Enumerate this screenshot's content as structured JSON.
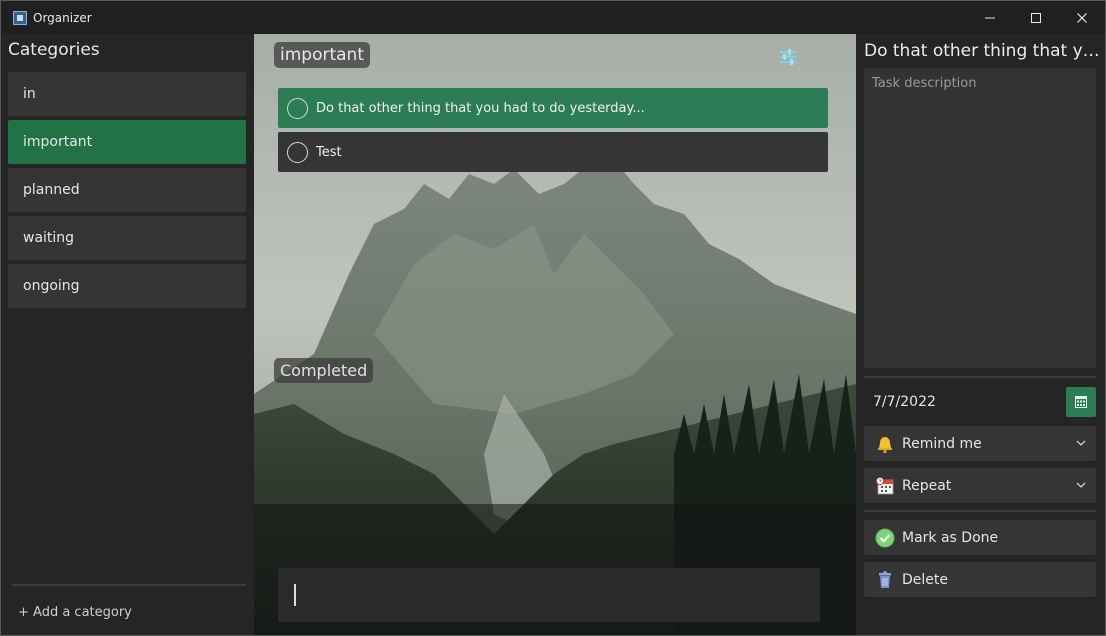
{
  "window": {
    "title": "Organizer",
    "icons": [
      "app-icon",
      "minimize-icon",
      "maximize-icon",
      "close-icon"
    ]
  },
  "sidebar": {
    "title": "Categories",
    "items": [
      {
        "label": "in",
        "selected": false
      },
      {
        "label": "important",
        "selected": true
      },
      {
        "label": "planned",
        "selected": false
      },
      {
        "label": "waiting",
        "selected": false
      },
      {
        "label": "ongoing",
        "selected": false
      }
    ],
    "add_label": "+ Add a category"
  },
  "main": {
    "list_title": "important",
    "filter_icon": "sliders-icon",
    "tasks": [
      {
        "label": "Do that other thing that you had to do yesterday...",
        "selected": true
      },
      {
        "label": "Test",
        "selected": false
      }
    ],
    "completed_label": "Completed",
    "new_task_value": ""
  },
  "details": {
    "title": "Do that other thing that you had to do yesterday...",
    "description_placeholder": "Task description",
    "date": "7/7/2022",
    "calendar_icon": "calendar-icon",
    "remind_label": "Remind me",
    "remind_icon": "bell-icon",
    "repeat_label": "Repeat",
    "repeat_icon": "repeat-calendar-icon",
    "done_label": "Mark as Done",
    "done_icon": "check-circle-icon",
    "delete_label": "Delete",
    "delete_icon": "trash-icon"
  },
  "colors": {
    "accent": "#217346",
    "task_selected": "#2c7d55",
    "panel": "#252525",
    "item": "#353535"
  }
}
